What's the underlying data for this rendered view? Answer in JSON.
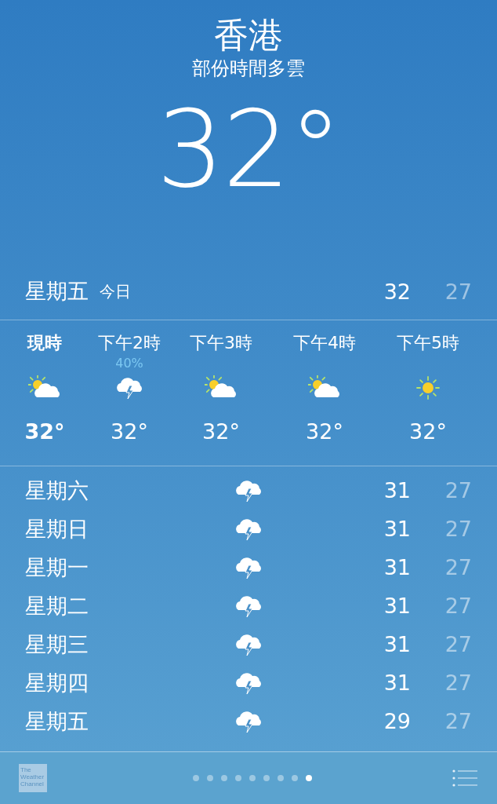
{
  "location": {
    "city": "香港",
    "condition": "部份時間多雲",
    "temperature": "32°"
  },
  "today": {
    "day": "星期五",
    "label": "今日",
    "high": "32",
    "low": "27"
  },
  "hourly": [
    {
      "time": "現時",
      "kind": "partly-sunny",
      "temp": "32°",
      "now": true
    },
    {
      "time": "下午2時",
      "precip": "40%",
      "kind": "thunder",
      "temp": "32°",
      "now": false
    },
    {
      "time": "下午3時",
      "kind": "partly-sunny",
      "temp": "32°",
      "now": false
    },
    {
      "time": "下午4時",
      "kind": "partly-sunny",
      "temp": "32°",
      "now": false
    },
    {
      "time": "下午5時",
      "kind": "sunny",
      "temp": "32°",
      "now": false
    }
  ],
  "daily": [
    {
      "day": "星期六",
      "kind": "thunder",
      "high": "31",
      "low": "27"
    },
    {
      "day": "星期日",
      "kind": "thunder",
      "high": "31",
      "low": "27"
    },
    {
      "day": "星期一",
      "kind": "thunder",
      "high": "31",
      "low": "27"
    },
    {
      "day": "星期二",
      "kind": "thunder",
      "high": "31",
      "low": "27"
    },
    {
      "day": "星期三",
      "kind": "thunder",
      "high": "31",
      "low": "27"
    },
    {
      "day": "星期四",
      "kind": "thunder",
      "high": "31",
      "low": "27"
    },
    {
      "day": "星期五",
      "kind": "thunder",
      "high": "29",
      "low": "27"
    }
  ],
  "footer": {
    "logo": "The Weather Channel",
    "pages": [
      {
        "selected": false
      },
      {
        "selected": false
      },
      {
        "selected": false
      },
      {
        "selected": false
      },
      {
        "selected": false
      },
      {
        "selected": false
      },
      {
        "selected": false
      },
      {
        "selected": false
      },
      {
        "selected": true
      }
    ]
  }
}
